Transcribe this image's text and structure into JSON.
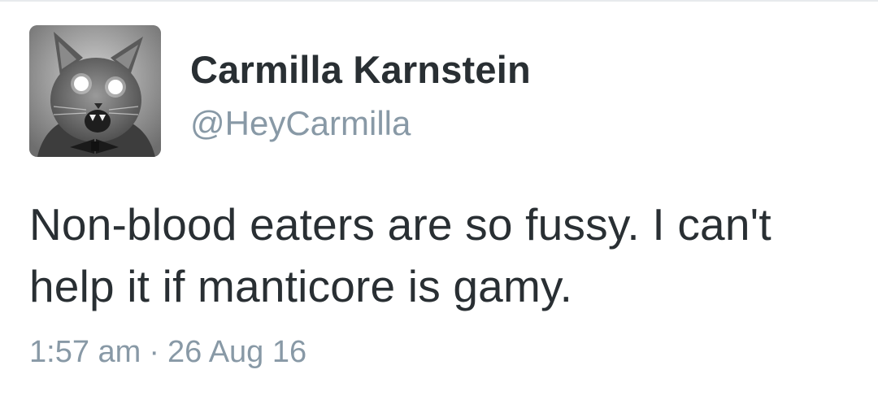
{
  "tweet": {
    "author": {
      "display_name": "Carmilla Karnstein",
      "handle": "@HeyCarmilla",
      "avatar_icon": "cat-photo-avatar"
    },
    "text": "Non-blood eaters are so fussy. I can't help it if manticore is gamy.",
    "time": "1:57 am",
    "separator": "·",
    "date": "26 Aug 16"
  },
  "colors": {
    "name": "#292f33",
    "secondary": "#8899a6",
    "divider": "#e7eaed"
  }
}
